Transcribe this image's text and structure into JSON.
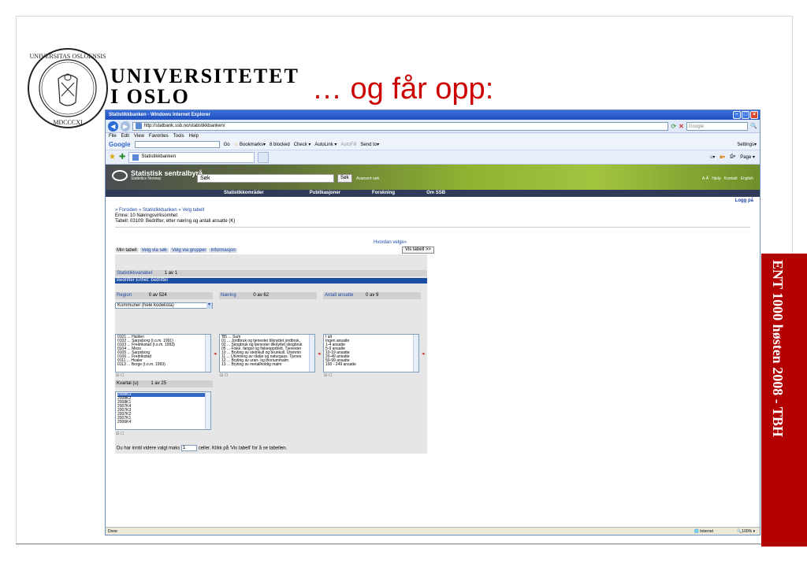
{
  "slide": {
    "university_line1": "UNIVERSITETET",
    "university_line2": "I OSLO",
    "headline": "… og får opp:",
    "sidebar_text": "ENT 1000 høsten 2008 - TBH",
    "seal_text": "UNIVERSITAS OSLOENSIS MDCCCXI"
  },
  "browser": {
    "window_title": "Statistikkbanken - Windows Internet Explorer",
    "address": "http://statbank.ssb.no/statistikkbanken/",
    "search_placeholder": "Google",
    "menu": [
      "File",
      "Edit",
      "View",
      "Favorites",
      "Tools",
      "Help"
    ],
    "google_toolbar": {
      "logo": "Google",
      "go": "Go",
      "bookmarks": "Bookmarks▾",
      "blocked": "8 blocked",
      "check": "Check ▾",
      "autolink": "AutoLink ▾",
      "autofill": "AutoFill",
      "sendto": "Send to▾",
      "settings": "Settings▾"
    },
    "tab_title": "Statistikkbanken",
    "page_label": "Page ▾",
    "status_left": "Done",
    "status_zone": "Internet",
    "status_zoom": "100%"
  },
  "ssb": {
    "logo_name": "Statistisk sentralbyrå",
    "logo_sub": "Statistics Norway",
    "search_value": "Søk",
    "search_button": "Søk",
    "advanced_search": "Avansert søk",
    "top_links": [
      "A-Å",
      "Hjelp",
      "Kontakt",
      "English"
    ],
    "nav": [
      "Statistikkområder",
      "Publikasjoner",
      "Forskning",
      "Om SSB"
    ],
    "login": "Logg på",
    "breadcrumb": "» Forsiden » Statistikkbanken » Velg tabell",
    "emne": "Emne: 10 Næringsvirksomhet",
    "tabell": "Tabell: 03109: Bedrifter, etter næring og antall ansatte (K)",
    "hvordan": "Hvordan velge»",
    "vis_tabell_button": "Vis tabell >>",
    "tabs": [
      {
        "label": "Min tabell",
        "active": true
      },
      {
        "label": "Velg via søk",
        "active": false
      },
      {
        "label": "Velg via grupper",
        "active": false
      },
      {
        "label": "Informasjon",
        "active": false
      }
    ],
    "statvar_label": "Statistikkvariabel",
    "statvar_count": "1 av 1",
    "bedrifter_row": "Bedrifter  Enhet: bedrifter",
    "region": {
      "label": "Region",
      "count": "0 av 524",
      "dropdown": "Kommuner (hele kodelista)",
      "items": [
        "0101 ... Halden",
        "0102 ... Sarpsborg (t.o.m. 1991)",
        "0103 ... Fredrikstad (t.o.m. 1993)",
        "0104 ... Moss",
        "0105 ... Sarpsborg",
        "0106 ... Fredrikstad",
        "0111 ... Hvaler",
        "0113 ... Borge (t.o.m. 1993)"
      ]
    },
    "naering": {
      "label": "Næring",
      "count": "0 av 62",
      "items": [
        "'B5 ... Sum",
        "01 ... Jordbruk og tjenester tilknyttet jordbruk,",
        "02 ... Skogbruk og tjenester tilknyttet skogbruk",
        "05 ... Fiske, fangst og fiskeoppdrett. Tjenester",
        "10 ... Bryting av steinkull og brunkull. Utvinnin",
        "11 ... Utvinning av råolje og naturgass. Tjenes",
        "12 ... Bryting av uran- og thoriummalm",
        "13 ... Bryting av metallholdig malm"
      ]
    },
    "ansatte": {
      "label": "Antall ansatte",
      "count": "0 av 9",
      "items": [
        "I alt",
        "Ingen ansatte",
        "1-4 ansatte",
        "5-9 ansatte",
        "10-19 ansatte",
        "20-49 ansatte",
        "50-99 ansatte",
        "100 - 249 ansatte"
      ]
    },
    "kvartal": {
      "label": "Kvartal (u)",
      "count": "1 av 25",
      "items": [
        "2008K3",
        "2008K2",
        "2008K1",
        "2007K4",
        "2007K3",
        "2007K2",
        "2007K1",
        "2006K4"
      ],
      "selected_index": 0
    },
    "maks_prefix": "Du har inntil videre valgt maks",
    "maks_value": "1",
    "maks_suffix": "celler. Klikk på 'Vis tabell' for å se tabellen."
  },
  "colors": {
    "headline": "#cc0000",
    "sidebar": "#b30000",
    "link": "#1c47a3",
    "selection": "#316ac5"
  }
}
